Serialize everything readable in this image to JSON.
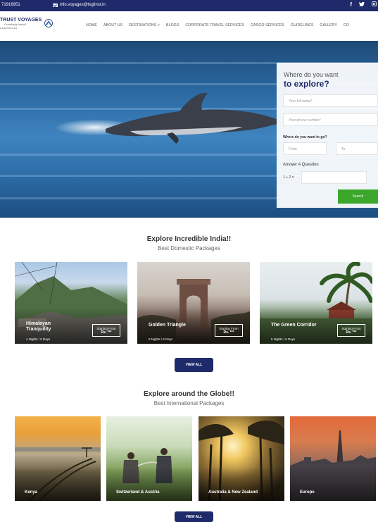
{
  "topbar": {
    "phone": "71916951",
    "email": "info.voyages@tsglinst.in",
    "socials": [
      "f",
      "t",
      "in"
    ]
  },
  "logo": {
    "brand": "TRUST VOYAGES",
    "tagline1": "Curating travel",
    "tagline2": "experiences"
  },
  "nav": {
    "items": [
      "HOME",
      "ABOUT US",
      "DESTINATIONS ˅",
      "BLOGS",
      "CORPORATE TRAVEL SERVICES",
      "CARGO SERVICES",
      "GUIDELINES",
      "GALLERY",
      "CO"
    ]
  },
  "form": {
    "title_line1": "Where do you want",
    "title_line2": "to explore?",
    "name_placeholder": "Your full name*",
    "phone_placeholder": "Your phone number*",
    "where_label": "Where do you want to go?",
    "from_placeholder": "From",
    "to_placeholder": "To",
    "question_label": "Answer A Question",
    "captcha": "1 + 2 =",
    "search_label": "Search"
  },
  "domestic": {
    "title": "Explore Incredible India!!",
    "subtitle": "Best Domestic Packages",
    "cards": [
      {
        "name_line1": "Himalayan",
        "name_line2": "Tranquility",
        "duration": "4 Nights / 5 Days",
        "price_label": "Starting From",
        "price": "Rs. ***"
      },
      {
        "name_line1": "Golden Triangle",
        "name_line2": "",
        "duration": "5 Nights / 6 Days",
        "price_label": "Starting From",
        "price": "Rs. ***"
      },
      {
        "name_line1": "The Green Corridor",
        "name_line2": "",
        "duration": "5 Nights / 6 Days",
        "price_label": "Starting From",
        "price": "Rs. ***"
      }
    ],
    "view_all": "VIEW ALL"
  },
  "international": {
    "title": "Explore around the Globe!!",
    "subtitle": "Best International Packages",
    "cards": [
      {
        "name": "Kenya"
      },
      {
        "name": "Switzerland & Austria"
      },
      {
        "name": "Australia & New Zealand"
      },
      {
        "name": "Europe"
      }
    ],
    "view_all": "VIEW ALL"
  }
}
